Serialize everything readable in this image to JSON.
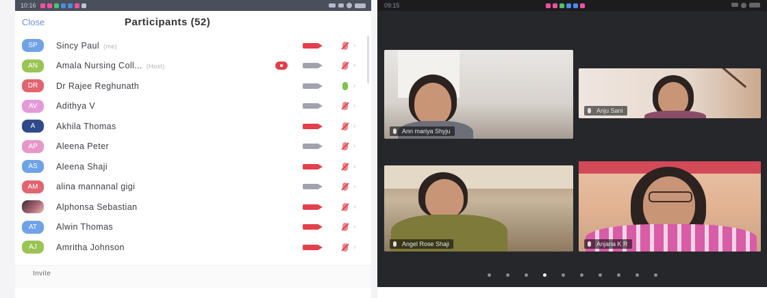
{
  "left": {
    "status": {
      "time": "10:16"
    },
    "header": {
      "close_label": "Close",
      "title": "Participants (52)"
    },
    "participants": [
      {
        "initials": "SP",
        "name": "Sincy Paul",
        "tag": "(me)",
        "color": "#6fa3e6",
        "cam": "red",
        "mic": "muted"
      },
      {
        "initials": "AN",
        "name": "Amala Nursing Coll...",
        "tag": "(Host)",
        "color": "#9ac456",
        "cam": "gray",
        "mic": "muted",
        "recording": true
      },
      {
        "initials": "DR",
        "name": "Dr Rajee Reghunath",
        "tag": "",
        "color": "#e0656f",
        "cam": "gray",
        "mic": "on"
      },
      {
        "initials": "AV",
        "name": "Adithya V",
        "tag": "",
        "color": "#e39ad6",
        "cam": "gray",
        "mic": "muted"
      },
      {
        "initials": "A",
        "name": "Akhila Thomas",
        "tag": "",
        "color": "#2f4a8a",
        "cam": "red",
        "mic": "muted"
      },
      {
        "initials": "AP",
        "name": "Aleena Peter",
        "tag": "",
        "color": "#e598c7",
        "cam": "gray",
        "mic": "muted"
      },
      {
        "initials": "AS",
        "name": "Aleena Shaji",
        "tag": "",
        "color": "#6fa3e6",
        "cam": "red",
        "mic": "muted"
      },
      {
        "initials": "AM",
        "name": "alina mannanal gigi",
        "tag": "",
        "color": "#e0656f",
        "cam": "gray",
        "mic": "muted"
      },
      {
        "initials": "",
        "name": "Alphonsa Sebastian",
        "tag": "",
        "color": "#7a4a56",
        "cam": "red",
        "mic": "muted",
        "photo": true
      },
      {
        "initials": "AT",
        "name": "Alwin Thomas",
        "tag": "",
        "color": "#6fa3e6",
        "cam": "red",
        "mic": "muted"
      },
      {
        "initials": "AJ",
        "name": "Amritha Johnson",
        "tag": "",
        "color": "#9ac456",
        "cam": "red",
        "mic": "muted"
      }
    ],
    "invite_label": "Invite"
  },
  "right": {
    "status": {
      "time": "09:15"
    },
    "tiles": [
      {
        "name": "Ann mariya Shyju"
      },
      {
        "name": "Anju Sani"
      },
      {
        "name": "Angel Rose Shaji"
      },
      {
        "name": "Anjana K R"
      }
    ],
    "page_count": 10,
    "active_page": 3
  },
  "colors": {
    "cam_red": "#e3404c",
    "cam_gray": "#a0a3ad",
    "mic_green": "#7cc24d",
    "mic_muted": "#e88a90"
  }
}
